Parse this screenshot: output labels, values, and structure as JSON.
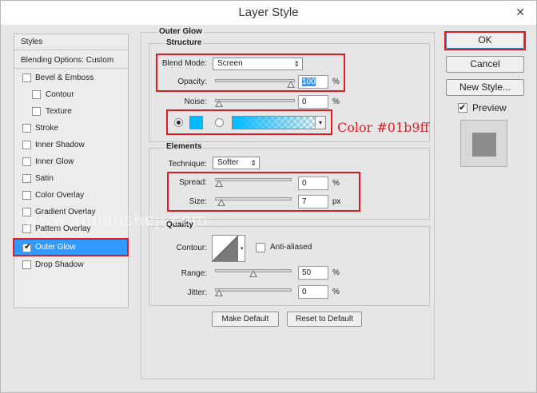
{
  "window": {
    "title": "Layer Style",
    "close_glyph": "✕"
  },
  "styles_list": {
    "header": "Styles",
    "blending": "Blending Options: Custom",
    "items": [
      {
        "label": "Bevel & Emboss",
        "checked": false
      },
      {
        "label": "Contour",
        "checked": false
      },
      {
        "label": "Texture",
        "checked": false
      },
      {
        "label": "Stroke",
        "checked": false
      },
      {
        "label": "Inner Shadow",
        "checked": false
      },
      {
        "label": "Inner Glow",
        "checked": false
      },
      {
        "label": "Satin",
        "checked": false
      },
      {
        "label": "Color Overlay",
        "checked": false
      },
      {
        "label": "Gradient Overlay",
        "checked": false
      },
      {
        "label": "Pattern Overlay",
        "checked": false
      },
      {
        "label": "Outer Glow",
        "checked": true
      },
      {
        "label": "Drop Shadow",
        "checked": false
      }
    ]
  },
  "outer_glow": {
    "title": "Outer Glow",
    "structure": {
      "title": "Structure",
      "blend_mode_label": "Blend Mode:",
      "blend_mode_value": "Screen",
      "opacity_label": "Opacity:",
      "opacity_value": "100",
      "opacity_unit": "%",
      "opacity_level": 1.0,
      "noise_label": "Noise:",
      "noise_value": "0",
      "noise_unit": "%",
      "noise_level": 0.0,
      "glow_color": "#01b9ff",
      "color_annotation": "Color #01b9ff"
    },
    "elements": {
      "title": "Elements",
      "technique_label": "Technique:",
      "technique_value": "Softer",
      "spread_label": "Spread:",
      "spread_value": "0",
      "spread_unit": "%",
      "spread_level": 0.0,
      "size_label": "Size:",
      "size_value": "7",
      "size_unit": "px",
      "size_level": 0.03
    },
    "quality": {
      "title": "Quality",
      "contour_label": "Contour:",
      "anti_aliased_label": "Anti-aliased",
      "anti_aliased_checked": false,
      "range_label": "Range:",
      "range_value": "50",
      "range_unit": "%",
      "range_level": 0.5,
      "jitter_label": "Jitter:",
      "jitter_value": "0",
      "jitter_unit": "%",
      "jitter_level": 0.0
    },
    "make_default": "Make Default",
    "reset_to_default": "Reset to Default"
  },
  "actions": {
    "ok": "OK",
    "cancel": "Cancel",
    "new_style": "New Style...",
    "preview_label": "Preview",
    "preview_checked": true
  },
  "watermark": "www.aidiansheji.com",
  "colors": {
    "highlight_red": "#e01b22",
    "selection_blue": "#3399ff",
    "annotation_text": "#e01b22",
    "preview_swatch": "#8c8c8c"
  }
}
